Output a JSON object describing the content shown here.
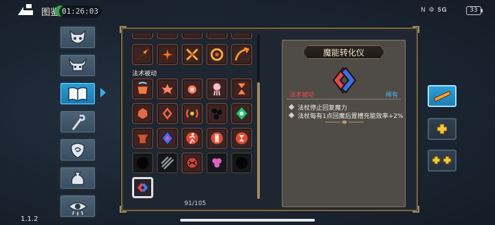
{
  "status_bar": {
    "title": "图鉴",
    "clock": "01:26:03",
    "sys_indicators": "N ⚙ 𝟓𝐆",
    "battery": "33"
  },
  "categories": [
    {
      "icon": "demon-mask-icon",
      "active": false
    },
    {
      "icon": "horned-skull-icon",
      "active": false
    },
    {
      "icon": "open-book-icon",
      "active": true
    },
    {
      "icon": "staff-icon",
      "active": false
    },
    {
      "icon": "shield-swirl-icon",
      "active": false
    },
    {
      "icon": "pouch-icon",
      "active": false
    },
    {
      "icon": "eye-icon",
      "active": false
    }
  ],
  "grid": {
    "section_label": "法术被动",
    "counter": "91/105",
    "scroll_position": 0.62
  },
  "detail": {
    "title": "魔能转化仪",
    "category": "法术被动",
    "rarity": "稀有",
    "effects": [
      "法杖停止回复魔力",
      "法杖每有1点回魔后置槽充能效率+2%"
    ]
  },
  "side_buttons": [
    {
      "icon": "wand-slot-icon",
      "active": true
    },
    {
      "icon": "single-plus-icon",
      "active": false
    },
    {
      "icon": "double-plus-icon",
      "active": false
    }
  ],
  "version": "1.1.2",
  "colors": {
    "accent_blue": "#2e9bd0",
    "passive_red": "#ef4c4c",
    "rare_blue": "#4fb3e8",
    "panel_gold": "#7a6a4c"
  }
}
